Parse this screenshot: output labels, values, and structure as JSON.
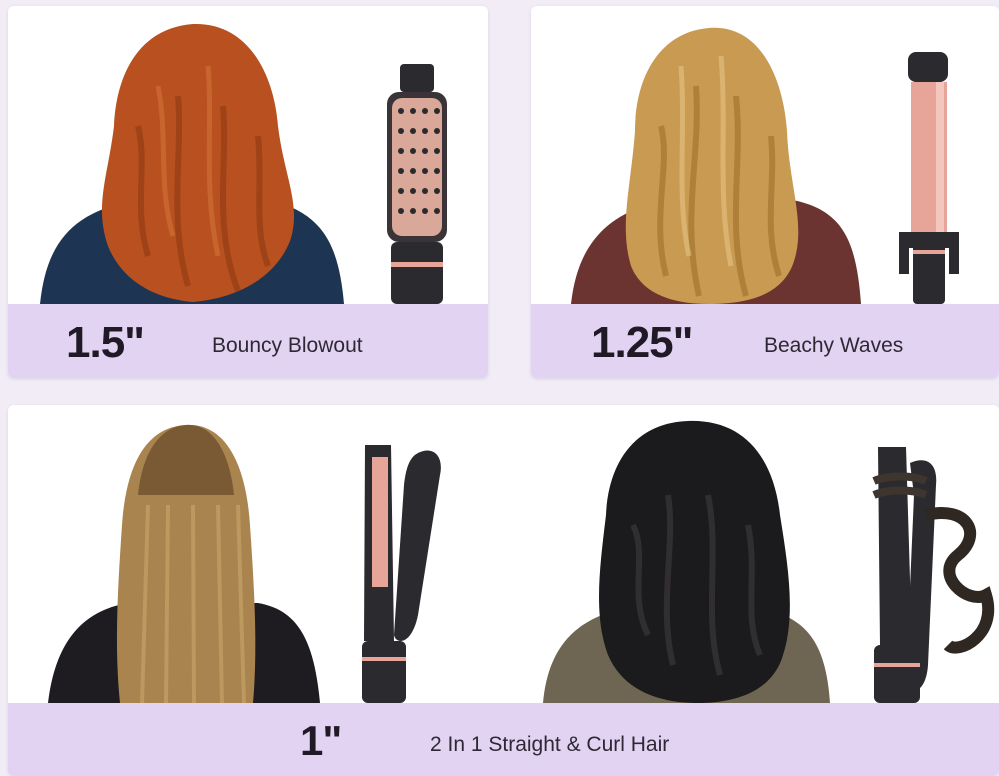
{
  "panels": [
    {
      "size": "1.5\"",
      "description": "Bouncy Blowout",
      "hair_color": "#b8511f",
      "tool_icon": "round-brush-icon"
    },
    {
      "size": "1.25\"",
      "description": "Beachy Waves",
      "hair_color": "#c99a52",
      "tool_icon": "curling-wand-icon"
    },
    {
      "size": "1\"",
      "description": "2 In 1 Straight & Curl Hair",
      "hair_color": "#a9844f",
      "tool_icon": "flat-iron-icon"
    }
  ],
  "colors": {
    "label_bar": "#e3d3f3",
    "page_background": "#f1ecf6",
    "tool_body": "#2b2a2e",
    "tool_accent": "#e7a59a"
  }
}
